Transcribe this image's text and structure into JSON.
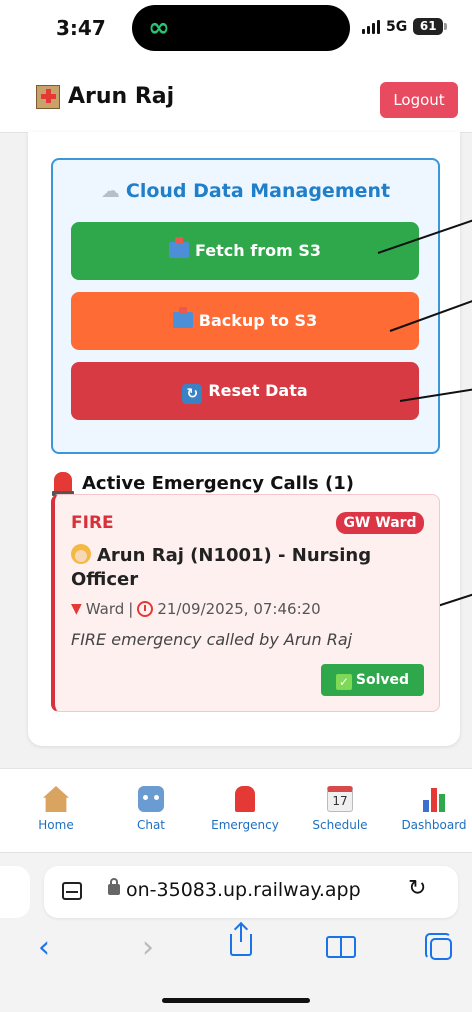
{
  "status_bar": {
    "time": "3:47",
    "network": "5G",
    "battery": "61"
  },
  "header": {
    "user_name": "Arun Raj",
    "logout_label": "Logout"
  },
  "cloud": {
    "title": "Cloud Data Management",
    "fetch_label": "Fetch from S3",
    "backup_label": "Backup to S3",
    "reset_label": "Reset Data",
    "colors": {
      "fetch": "#2ea84a",
      "backup": "#ff6b35",
      "reset": "#d83a44",
      "accent": "#1f7fc9"
    }
  },
  "emergency": {
    "heading": "Active Emergency Calls (1)",
    "calls": [
      {
        "type": "FIRE",
        "ward": "GW Ward",
        "caller": "Arun Raj (N1001) - Nursing Officer",
        "location": "Ward",
        "datetime": "21/09/2025, 07:46:20",
        "description": "FIRE emergency called by Arun Raj",
        "status_label": "Solved"
      }
    ]
  },
  "nav": {
    "items": [
      {
        "label": "Home",
        "icon": "home-icon"
      },
      {
        "label": "Chat",
        "icon": "robot-icon"
      },
      {
        "label": "Emergency",
        "icon": "siren-icon"
      },
      {
        "label": "Schedule",
        "icon": "calendar-icon",
        "icon_text": "17"
      },
      {
        "label": "Dashboard",
        "icon": "bar-chart-icon"
      }
    ]
  },
  "browser": {
    "url": "on-35083.up.railway.app"
  }
}
